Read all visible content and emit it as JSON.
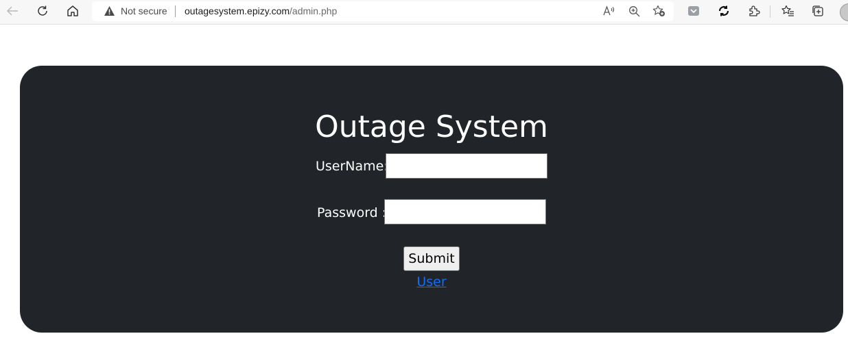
{
  "browser": {
    "security_label": "Not secure",
    "url_host": "outagesystem.epizy.com",
    "url_path": "/admin.php",
    "icons": [
      "back-arrow-icon",
      "refresh-icon",
      "home-icon",
      "warning-icon",
      "read-aloud-icon",
      "zoom-in-icon",
      "add-favorite-icon",
      "pocket-icon",
      "sync-icon",
      "extensions-icon",
      "favorites-icon",
      "collections-icon",
      "profile-avatar-icon"
    ]
  },
  "page": {
    "title": "Outage System",
    "username_label": "UserName:",
    "username_value": "",
    "password_label": "Password :",
    "password_value": "",
    "submit_label": "Submit",
    "user_link_label": "User",
    "card_color": "#212529",
    "link_color": "#0d6efd"
  }
}
